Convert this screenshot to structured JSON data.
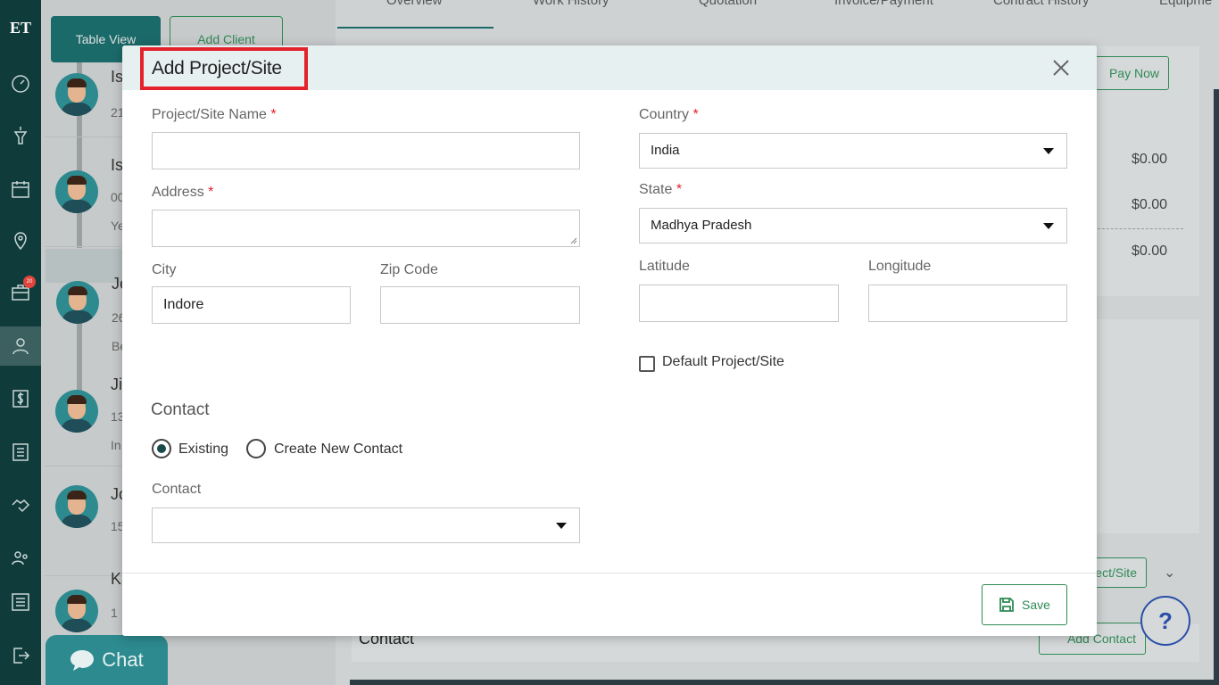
{
  "app": {
    "logo": "ET"
  },
  "sidebar": {
    "icons": [
      "dashboard-icon",
      "funnel-icon",
      "calendar-icon",
      "map-pin-icon",
      "briefcase-icon",
      "user-icon",
      "dollar-icon",
      "list-icon",
      "handshake-icon",
      "team-icon",
      "settings-icon",
      "logout-icon"
    ],
    "badge": "20"
  },
  "client_panel": {
    "table_view_label": "Table View",
    "add_client_label": "Add Client",
    "rows": [
      {
        "name": "Is",
        "sub1": "21"
      },
      {
        "name": "Is",
        "sub1": "00",
        "sub2": "Ye"
      },
      {
        "name": "Je",
        "sub1": "26",
        "sub2": "Be"
      },
      {
        "name": "Ji",
        "sub1": "13",
        "sub2": "In"
      },
      {
        "name": "Jo",
        "sub1": "15"
      },
      {
        "name": "Ka",
        "sub1": "1"
      }
    ]
  },
  "tabs": [
    "Overview",
    "Work History",
    "Quotation",
    "Invoice/Payment",
    "Contract History",
    "Equipme"
  ],
  "right_panel": {
    "pay_now": "Pay Now",
    "amounts": [
      "$0.00",
      "$0.00",
      "$0.00"
    ],
    "project_site_btn": "ect/Site",
    "contact_section": "Contact",
    "add_contact": "Add Contact",
    "help": "?"
  },
  "chat": {
    "label": "Chat"
  },
  "modal": {
    "title": "Add Project/Site",
    "fields": {
      "project_name": {
        "label": "Project/Site Name",
        "required": "*",
        "value": ""
      },
      "address": {
        "label": "Address",
        "required": "*",
        "value": ""
      },
      "city": {
        "label": "City",
        "value": "Indore"
      },
      "zip": {
        "label": "Zip Code",
        "value": ""
      },
      "country": {
        "label": "Country",
        "required": "*",
        "value": "India"
      },
      "state": {
        "label": "State",
        "required": "*",
        "value": "Madhya Pradesh"
      },
      "latitude": {
        "label": "Latitude",
        "value": ""
      },
      "longitude": {
        "label": "Longitude",
        "value": ""
      }
    },
    "default_checkbox": {
      "label": "Default Project/Site",
      "checked": false
    },
    "contact_section": {
      "title": "Contact",
      "options": [
        "Existing",
        "Create New Contact"
      ],
      "selected": "Existing",
      "contact_label": "Contact",
      "contact_value": ""
    },
    "save_label": "Save"
  },
  "colors": {
    "brand_dark": "#103b3b",
    "accent_green": "#2f8a55",
    "required_red": "#e3222c",
    "highlight_box": "#e3222c"
  }
}
